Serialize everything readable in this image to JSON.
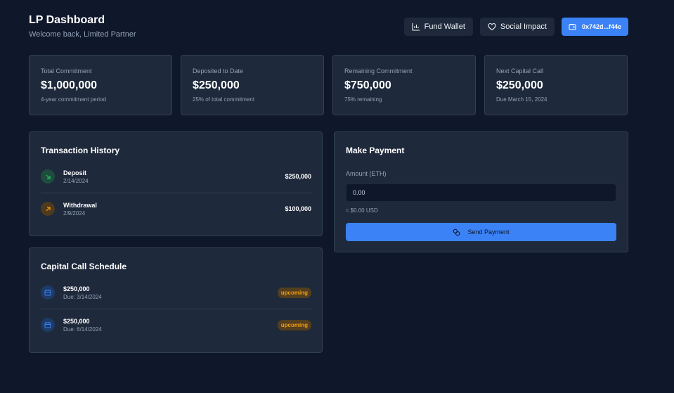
{
  "header": {
    "title": "LP Dashboard",
    "subtitle": "Welcome back, Limited Partner",
    "fund_wallet_label": "Fund Wallet",
    "social_impact_label": "Social Impact",
    "wallet_address": "0x742d...f44e"
  },
  "stats": [
    {
      "label": "Total Commitment",
      "value": "$1,000,000",
      "note": "4-year commitment period"
    },
    {
      "label": "Deposited to Date",
      "value": "$250,000",
      "note": "25% of total commitment"
    },
    {
      "label": "Remaining Commitment",
      "value": "$750,000",
      "note": "75% remaining"
    },
    {
      "label": "Next Capital Call",
      "value": "$250,000",
      "note": "Due March 15, 2024"
    }
  ],
  "transactions": {
    "title": "Transaction History",
    "items": [
      {
        "type": "Deposit",
        "date": "2/14/2024",
        "amount": "$250,000",
        "icon": "arrow-down-right-icon",
        "color": "#22c55e"
      },
      {
        "type": "Withdrawal",
        "date": "2/9/2024",
        "amount": "$100,000",
        "icon": "arrow-up-right-icon",
        "color": "#f59e0b"
      }
    ]
  },
  "capital_calls": {
    "title": "Capital Call Schedule",
    "items": [
      {
        "amount": "$250,000",
        "due": "Due: 3/14/2024",
        "status": "upcoming",
        "icon": "calendar-icon"
      },
      {
        "amount": "$250,000",
        "due": "Due: 6/14/2024",
        "status": "upcoming",
        "icon": "calendar-icon"
      }
    ]
  },
  "payment": {
    "title": "Make Payment",
    "amount_label": "Amount (ETH)",
    "amount_value": "0.00",
    "usd_estimate": "≈ $0.00 USD",
    "send_label": "Send Payment"
  },
  "colors": {
    "background": "#0f172a",
    "card": "#1e293b",
    "accent": "#3b82f6",
    "deposit": "#22c55e",
    "withdrawal": "#f59e0b"
  }
}
